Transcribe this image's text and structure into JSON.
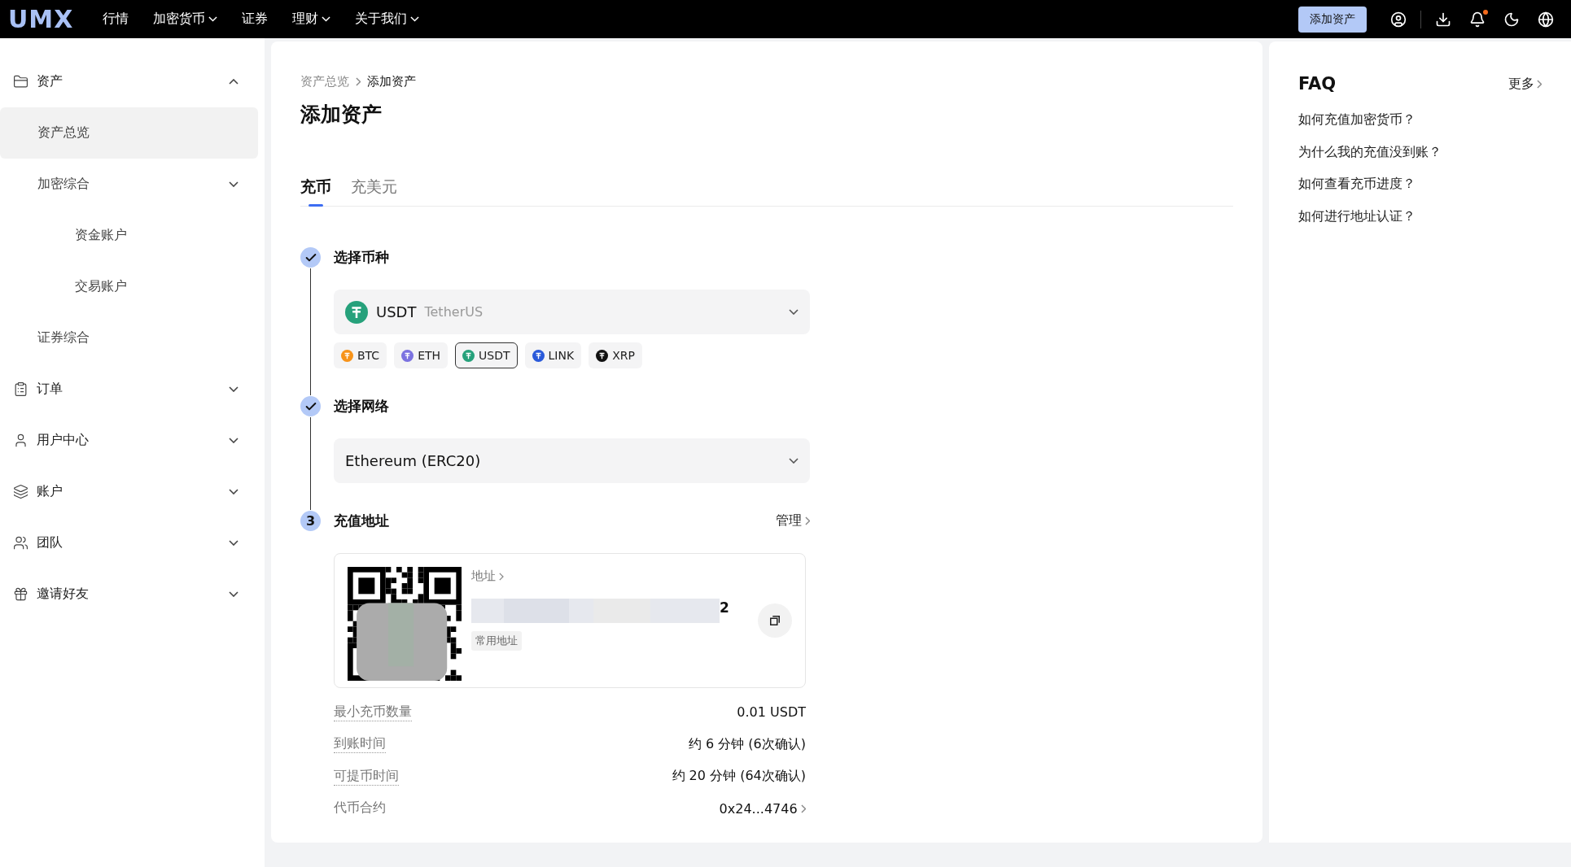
{
  "topbar": {
    "logo": "UMX",
    "nav": [
      {
        "label": "行情",
        "dropdown": false
      },
      {
        "label": "加密货币",
        "dropdown": true
      },
      {
        "label": "证券",
        "dropdown": false
      },
      {
        "label": "理财",
        "dropdown": true
      },
      {
        "label": "关于我们",
        "dropdown": true
      }
    ],
    "add_button": "添加资产",
    "notification_dot": true
  },
  "sidebar": {
    "items": [
      {
        "label": "资产",
        "expanded": true,
        "children": [
          {
            "label": "资产总览",
            "selected": true
          },
          {
            "label": "加密综合",
            "selected": false,
            "expanded": false,
            "children": [
              {
                "label": "资金账户",
                "selected": false
              },
              {
                "label": "交易账户",
                "selected": false
              }
            ]
          },
          {
            "label": "证券综合",
            "selected": false
          }
        ]
      },
      {
        "label": "订单",
        "expanded": false
      },
      {
        "label": "用户中心",
        "expanded": false
      },
      {
        "label": "账户",
        "expanded": false
      },
      {
        "label": "团队",
        "expanded": false
      },
      {
        "label": "邀请好友",
        "expanded": false
      }
    ]
  },
  "main": {
    "breadcrumb": [
      "资产总览",
      "添加资产"
    ],
    "title": "添加资产",
    "tabs": [
      {
        "label": "充币",
        "selected": true
      },
      {
        "label": "充美元",
        "selected": false
      }
    ],
    "steps": [
      {
        "done": true,
        "title": "选择币种",
        "kind": "coin",
        "select": {
          "symbol": "USDT",
          "name": "TetherUS"
        },
        "coins": [
          {
            "symbol": "BTC",
            "color": "#f7931a",
            "selected": false
          },
          {
            "symbol": "ETH",
            "color": "#7b72e0",
            "selected": false
          },
          {
            "symbol": "USDT",
            "color": "#26a17b",
            "selected": true
          },
          {
            "symbol": "LINK",
            "color": "#2a5ada",
            "selected": false
          },
          {
            "symbol": "XRP",
            "color": "#111111",
            "selected": false
          }
        ]
      },
      {
        "done": true,
        "title": "选择网络",
        "kind": "network",
        "select": {
          "value": "Ethereum (ERC20)"
        }
      },
      {
        "done": false,
        "number": "3",
        "title": "充值地址",
        "kind": "address",
        "manage": "管理",
        "address_label": "地址",
        "address_tail": "2",
        "tag": "常用地址"
      }
    ],
    "details": [
      {
        "label": "最小充币数量",
        "value": "0.01 USDT",
        "dotted": true,
        "link": false
      },
      {
        "label": "到账时间",
        "value": "约 6 分钟 (6次确认)",
        "dotted": true,
        "link": false
      },
      {
        "label": "可提币时间",
        "value": "约 20 分钟 (64次确认)",
        "dotted": true,
        "link": false
      },
      {
        "label": "代币合约",
        "value": "0x24...4746",
        "dotted": false,
        "link": true
      }
    ]
  },
  "faq": {
    "title": "FAQ",
    "more": "更多",
    "questions": [
      "如何充值加密货币？",
      "为什么我的充值没到账？",
      "如何查看充币进度？",
      "如何进行地址认证？"
    ]
  }
}
